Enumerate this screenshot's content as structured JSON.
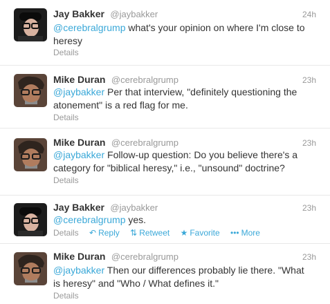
{
  "colors": {
    "link": "#3aa8d8",
    "meta": "#999999",
    "text": "#333333",
    "divider": "#e8e8e8"
  },
  "tweets": [
    {
      "name": "Jay Bakker",
      "handle": "@jaybakker",
      "time": "24h",
      "mention": "@cerebralgrump",
      "body": " what's your opinion on where I'm close to heresy",
      "details": "Details",
      "avatar": "jay-bakker-avatar"
    },
    {
      "name": "Mike Duran",
      "handle": "@cerebralgrump",
      "time": "23h",
      "mention": "@jaybakker",
      "body": " Per that interview, \"definitely questioning the atonement\" is a red flag for me.",
      "details": "Details",
      "avatar": "mike-duran-avatar"
    },
    {
      "name": "Mike Duran",
      "handle": "@cerebralgrump",
      "time": "23h",
      "mention": "@jaybakker",
      "body": " Follow-up question: Do you believe there's a category for \"biblical heresy,\" i.e., \"unsound\" doctrine?",
      "details": "Details",
      "avatar": "mike-duran-avatar"
    },
    {
      "name": "Jay Bakker",
      "handle": "@jaybakker",
      "time": "23h",
      "mention": "@cerebralgrump",
      "body": " yes.",
      "details": "Details",
      "reply": "Reply",
      "retweet": "Retweet",
      "favorite": "Favorite",
      "more": "More",
      "avatar": "jay-bakker-avatar"
    },
    {
      "name": "Mike Duran",
      "handle": "@cerebralgrump",
      "time": "23h",
      "mention": "@jaybakker",
      "body": " Then our differences probably lie there. \"What is heresy\" and \"Who / What defines it.\"",
      "details": "Details",
      "avatar": "mike-duran-avatar"
    }
  ]
}
